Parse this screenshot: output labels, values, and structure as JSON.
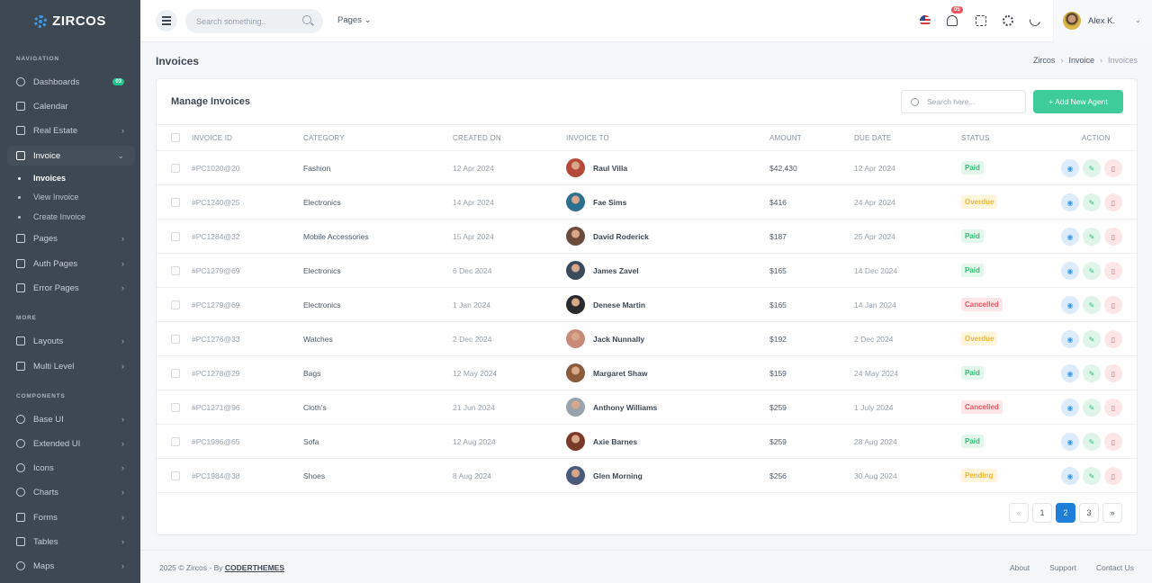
{
  "brand": "ZIRCOS",
  "sidebar": {
    "sections": [
      "NAVIGATION",
      "MORE",
      "COMPONENTS"
    ],
    "items": [
      {
        "label": "Dashboards",
        "badge": "03"
      },
      {
        "label": "Calendar"
      },
      {
        "label": "Real Estate"
      },
      {
        "label": "Invoice"
      },
      {
        "label": "Pages"
      },
      {
        "label": "Auth Pages"
      },
      {
        "label": "Error Pages"
      },
      {
        "label": "Layouts"
      },
      {
        "label": "Multi Level"
      },
      {
        "label": "Base UI"
      },
      {
        "label": "Extended UI"
      },
      {
        "label": "Icons"
      },
      {
        "label": "Charts"
      },
      {
        "label": "Forms"
      },
      {
        "label": "Tables"
      },
      {
        "label": "Maps"
      }
    ],
    "invoice_sub": [
      "Invoices",
      "View Invoice",
      "Create Invoice"
    ]
  },
  "topbar": {
    "search_placeholder": "Search something..",
    "pages_label": "Pages",
    "notification_count": "05",
    "user_name": "Alex K."
  },
  "page": {
    "title": "Invoices",
    "breadcrumb": [
      "Zircos",
      "Invoice",
      "Invoices"
    ]
  },
  "card": {
    "title": "Manage Invoices",
    "search_placeholder": "Search here...",
    "add_button": "+ Add New Agent"
  },
  "table": {
    "headers": [
      "INVOICE ID",
      "CATEGORY",
      "CREATED ON",
      "INVOICE TO",
      "AMOUNT",
      "DUE DATE",
      "STATUS",
      "ACTION"
    ],
    "rows": [
      {
        "id": "#PC1020@20",
        "category": "Fashion",
        "created": "12 Apr 2024",
        "name": "Raul Villa",
        "amount": "$42,430",
        "due": "12 Apr 2024",
        "status": "Paid"
      },
      {
        "id": "#PC1240@25",
        "category": "Electronics",
        "created": "14 Apr 2024",
        "name": "Fae Sims",
        "amount": "$416",
        "due": "24 Apr 2024",
        "status": "Overdue"
      },
      {
        "id": "#PC1284@32",
        "category": "Mobile Accessories",
        "created": "15 Apr 2024",
        "name": "David Roderick",
        "amount": "$187",
        "due": "25 Apr 2024",
        "status": "Paid"
      },
      {
        "id": "#PC1279@69",
        "category": "Electronics",
        "created": "6 Dec 2024",
        "name": "James Zavel",
        "amount": "$165",
        "due": "14 Dec 2024",
        "status": "Paid"
      },
      {
        "id": "#PC1279@69",
        "category": "Electronics",
        "created": "1 Jan 2024",
        "name": "Denese Martin",
        "amount": "$165",
        "due": "14 Jan 2024",
        "status": "Cancelled"
      },
      {
        "id": "#PC1276@33",
        "category": "Watches",
        "created": "2 Dec 2024",
        "name": "Jack Nunnally",
        "amount": "$192",
        "due": "2 Dec 2024",
        "status": "Overdue"
      },
      {
        "id": "#PC1278@29",
        "category": "Bags",
        "created": "12 May 2024",
        "name": "Margaret Shaw",
        "amount": "$159",
        "due": "24 May 2024",
        "status": "Paid"
      },
      {
        "id": "#PC1271@96",
        "category": "Cloth's",
        "created": "21 Jun 2024",
        "name": "Anthony Williams",
        "amount": "$259",
        "due": "1 July 2024",
        "status": "Cancelled"
      },
      {
        "id": "#PC1986@65",
        "category": "Sofa",
        "created": "12 Aug 2024",
        "name": "Axie Barnes",
        "amount": "$259",
        "due": "28 Aug 2024",
        "status": "Paid"
      },
      {
        "id": "#PC1984@38",
        "category": "Shoes",
        "created": "8 Aug 2024",
        "name": "Glen Morning",
        "amount": "$256",
        "due": "30 Aug 2024",
        "status": "Pending"
      }
    ]
  },
  "pagination": {
    "prev": "«",
    "pages": [
      "1",
      "2",
      "3"
    ],
    "active": "2",
    "next": "»"
  },
  "footer": {
    "copyright": "2025 © Zircos - By",
    "author": "CODERTHEMES",
    "links": [
      "About",
      "Support",
      "Contact Us"
    ]
  },
  "colors": {
    "sidebar_bg": "#3e4853",
    "accent_green": "#3ecd9a",
    "primary_blue": "#1f7fd8",
    "paid": "#2fbe74",
    "overdue": "#f5b633",
    "cancelled": "#f0555f"
  }
}
